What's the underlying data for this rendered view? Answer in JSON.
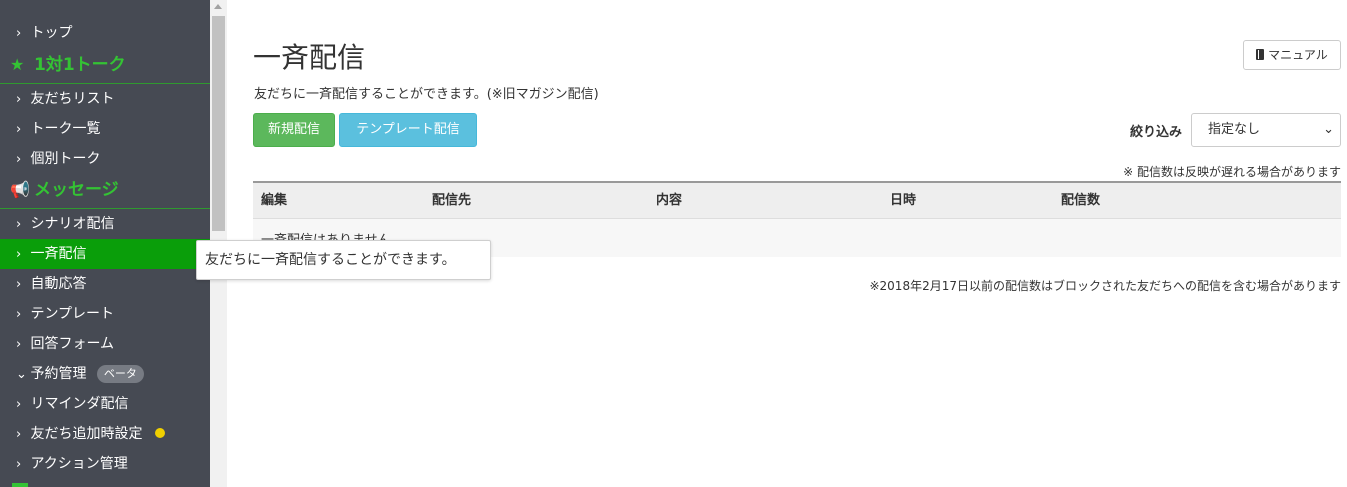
{
  "sidebar": {
    "items_top": [
      {
        "label": "トップ"
      }
    ],
    "section_talk": {
      "icon": "star-icon",
      "label": "1対1トーク"
    },
    "talk_items": [
      {
        "label": "友だちリスト"
      },
      {
        "label": "トーク一覧"
      },
      {
        "label": "個別トーク"
      }
    ],
    "section_message": {
      "icon": "megaphone-icon",
      "label": "メッセージ"
    },
    "message_items": [
      {
        "label": "シナリオ配信"
      },
      {
        "label": "一斉配信",
        "active": true
      },
      {
        "label": "自動応答"
      },
      {
        "label": "テンプレート"
      },
      {
        "label": "回答フォーム"
      },
      {
        "label": "予約管理",
        "badge": "ベータ",
        "expanded": true
      },
      {
        "label": "リマインダ配信"
      },
      {
        "label": "友だち追加時設定",
        "dot_color": "#f0d000"
      },
      {
        "label": "アクション管理"
      }
    ]
  },
  "colors": {
    "sidebar_bg": "#464a53",
    "accent_green": "#34c334",
    "active_bg": "#0a9e0a",
    "btn_success": "#5cb85c",
    "btn_info": "#5bc0de"
  },
  "main": {
    "title": "一斉配信",
    "description": "友だちに一斉配信することができます。(※旧マガジン配信)",
    "manual_label": "マニュアル",
    "new_button": "新規配信",
    "template_button": "テンプレート配信",
    "filter_label": "絞り込み",
    "filter_value": "指定なし",
    "delay_note": "※ 配信数は反映が遅れる場合があります",
    "table": {
      "headers": [
        "編集",
        "配信先",
        "内容",
        "日時",
        "配信数"
      ],
      "empty_text": "一斉配信はありません"
    },
    "footnote": "※2018年2月17日以前の配信数はブロックされた友だちへの配信を含む場合があります"
  },
  "tooltip": "友だちに一斉配信することができます。"
}
